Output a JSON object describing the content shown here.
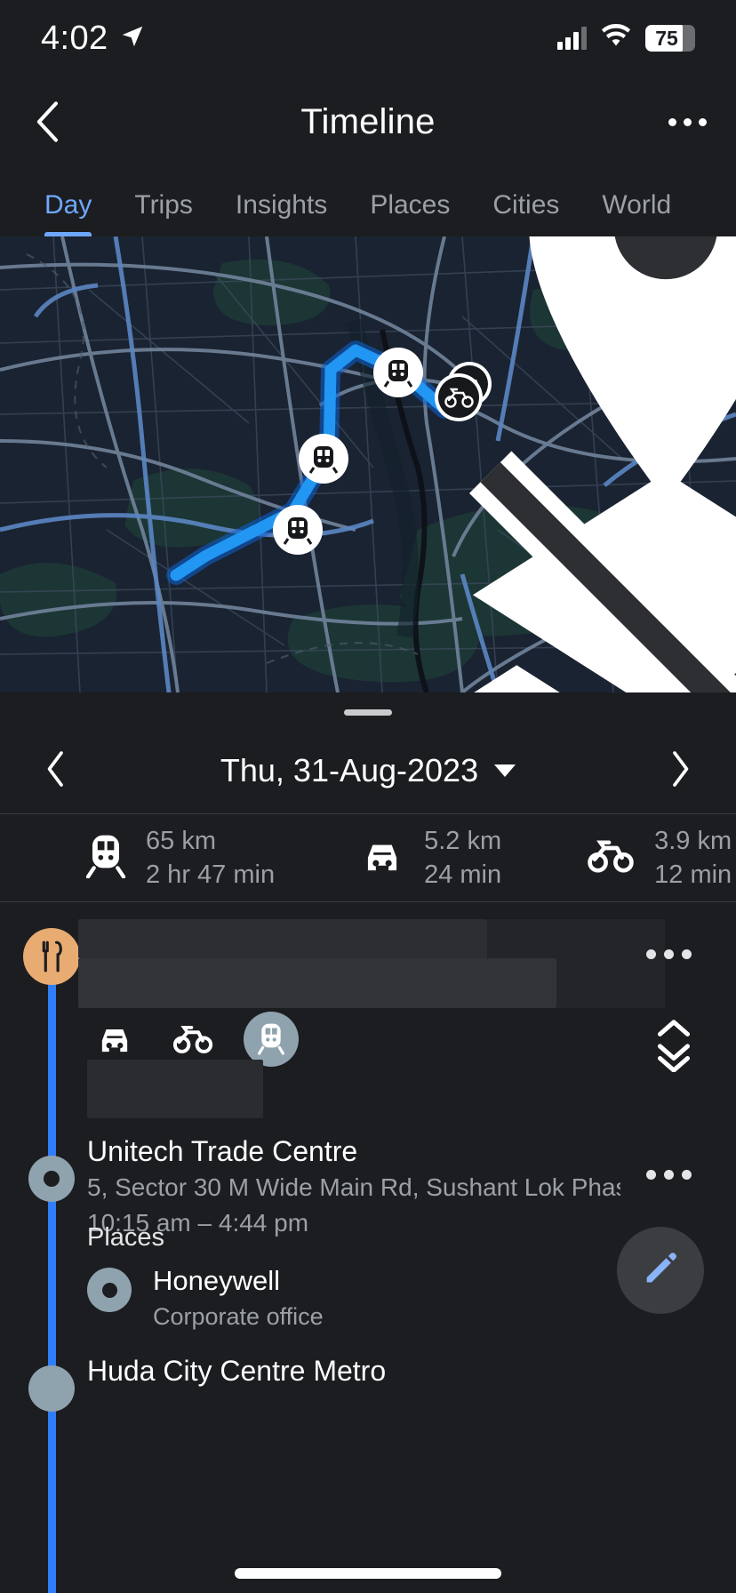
{
  "status_bar": {
    "time": "4:02",
    "location_icon": "location-arrow-icon",
    "signal_icon": "cellular-signal-icon",
    "wifi_icon": "wifi-icon",
    "battery_level": "75"
  },
  "app_bar": {
    "back_icon": "chevron-left-icon",
    "title": "Timeline",
    "overflow_icon": "more-horizontal-icon"
  },
  "tabs": {
    "active": "Day",
    "items": [
      {
        "label": "Day"
      },
      {
        "label": "Trips"
      },
      {
        "label": "Insights"
      },
      {
        "label": "Places"
      },
      {
        "label": "Cities"
      },
      {
        "label": "World"
      }
    ]
  },
  "map": {
    "pin_button_icon": "location-pin-icon",
    "layers_button_icon": "layers-off-icon",
    "markers": [
      {
        "type": "train-icon"
      },
      {
        "type": "train-icon"
      },
      {
        "type": "train-icon"
      },
      {
        "type": "car-icon"
      },
      {
        "type": "motorcycle-icon"
      }
    ],
    "route_color": "#2196f3"
  },
  "date_bar": {
    "prev_icon": "chevron-left-icon",
    "label": "Thu, 31-Aug-2023",
    "dropdown_icon": "caret-down-icon",
    "next_icon": "chevron-right-icon"
  },
  "stats": [
    {
      "icon": "train-icon",
      "distance": "65 km",
      "duration": "2 hr 47 min"
    },
    {
      "icon": "car-icon",
      "distance": "5.2 km",
      "duration": "24 min"
    },
    {
      "icon": "motorcycle-icon",
      "distance": "3.9 km",
      "duration": "12 min"
    }
  ],
  "timeline": {
    "entry_food": {
      "icon": "restaurant-icon",
      "icon_color": "#e8ab72",
      "content_redacted": true,
      "overflow_icon": "more-horizontal-icon"
    },
    "transport_modes": {
      "options": [
        {
          "icon": "car-icon",
          "selected": false
        },
        {
          "icon": "motorcycle-icon",
          "selected": false
        },
        {
          "icon": "train-icon",
          "selected": true
        }
      ],
      "expand_icon": "double-chevron-expand-icon"
    },
    "place_visit": {
      "name": "Unitech Trade Centre",
      "address": "5, Sector 30 M Wide Main Rd, Sushant Lok Phas…",
      "time_range": "10:15 am – 4:44 pm",
      "overflow_icon": "more-horizontal-icon",
      "places_heading": "Places",
      "places": [
        {
          "name": "Honeywell",
          "category": "Corporate office"
        }
      ]
    },
    "last_entry": {
      "name": "Huda City Centre Metro"
    }
  },
  "fab": {
    "icon": "edit-pencil-icon",
    "icon_color": "#8ab4f8"
  }
}
